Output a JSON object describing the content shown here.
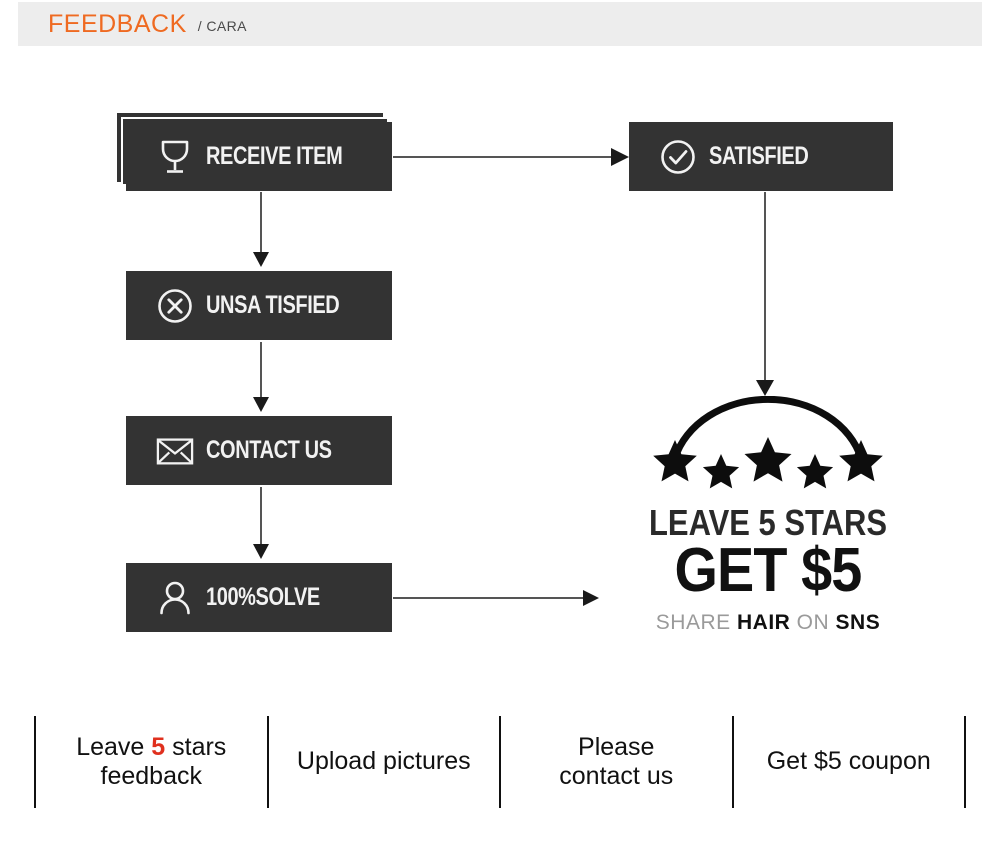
{
  "header": {
    "title": "FEEDBACK",
    "subtitle": "/ CARA",
    "accent_color": "#ef6a21",
    "bar_color": "#ededed"
  },
  "flow": {
    "box_color": "#333333",
    "text_color": "#f2f2f2",
    "boxes": [
      {
        "id": "receive-item",
        "label": "RECEIVE ITEM",
        "icon": "wine-glass-icon",
        "stacked": true
      },
      {
        "id": "satisfied",
        "label": "SATISFIED",
        "icon": "check-circle-icon",
        "stacked": false
      },
      {
        "id": "unsatisfied",
        "label": "UNSA TISFIED",
        "icon": "x-circle-icon",
        "stacked": false
      },
      {
        "id": "contact-us",
        "label": "CONTACT US",
        "icon": "envelope-icon",
        "stacked": false
      },
      {
        "id": "solve",
        "label": "100%SOLVE",
        "icon": "person-icon",
        "stacked": false
      }
    ],
    "connectors": [
      {
        "from": "receive-item",
        "to": "satisfied",
        "direction": "right"
      },
      {
        "from": "receive-item",
        "to": "unsatisfied",
        "direction": "down"
      },
      {
        "from": "unsatisfied",
        "to": "contact-us",
        "direction": "down"
      },
      {
        "from": "contact-us",
        "to": "solve",
        "direction": "down"
      },
      {
        "from": "satisfied",
        "to": "rating",
        "direction": "down"
      },
      {
        "from": "solve",
        "to": "rating",
        "direction": "right"
      }
    ]
  },
  "rating": {
    "stars_count": 5,
    "arc_icon": "arc-over-stars-icon",
    "headline": "LEAVE 5 STARS",
    "subhead": "GET $5",
    "share": {
      "word1": "SHARE",
      "word2": "HAIR",
      "word3": "ON",
      "word4": "SNS",
      "gray_color": "#9a9a9a",
      "black_color": "#111111"
    }
  },
  "bottom_bar": {
    "highlight_color": "#e0301e",
    "cells": [
      {
        "id": "leave-5-stars-feedback",
        "pre": "Leave ",
        "hi": "5",
        "post": " stars",
        "line2": "feedback"
      },
      {
        "id": "upload-pictures",
        "pre": "Upload pictures",
        "hi": "",
        "post": "",
        "line2": ""
      },
      {
        "id": "please-contact-us",
        "pre": "Please",
        "hi": "",
        "post": "",
        "line2": "contact us"
      },
      {
        "id": "get-5-coupon",
        "pre": "Get $5 coupon",
        "hi": "",
        "post": "",
        "line2": ""
      }
    ]
  }
}
